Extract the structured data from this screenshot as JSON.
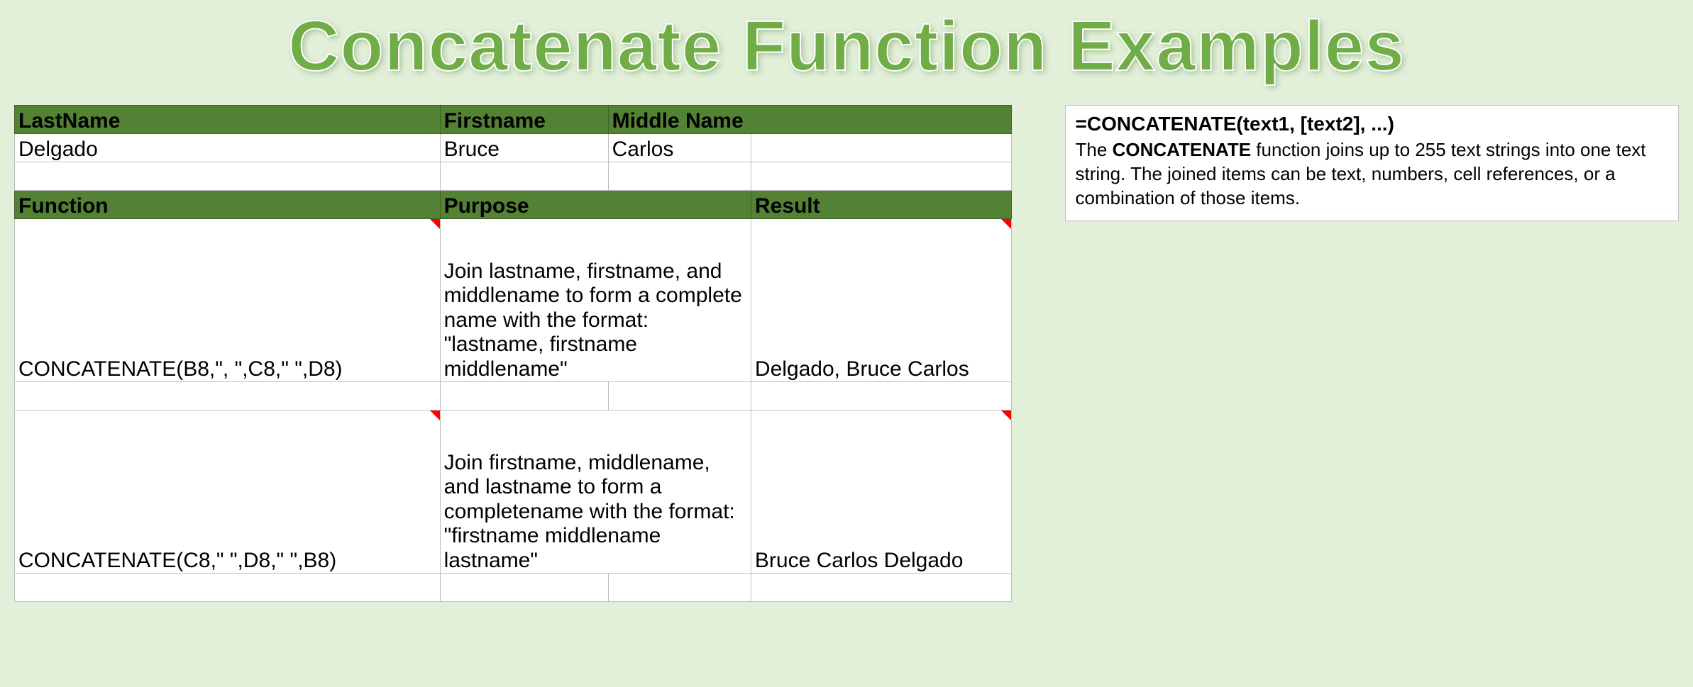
{
  "title": "Concatenate Function Examples",
  "table": {
    "header1": {
      "col1": "LastName",
      "col2": "Firstname",
      "col3": "Middle Name"
    },
    "data1": {
      "col1": "Delgado",
      "col2": "Bruce",
      "col3": "Carlos"
    },
    "header2": {
      "col1": "Function",
      "col2": "Purpose",
      "col4": "Result"
    },
    "row1": {
      "func": "CONCATENATE(B8,\", \",C8,\" \",D8)",
      "purpose": "Join lastname, firstname, and middlename to form a complete name with the format: \"lastname, firstname middlename\"",
      "result": "Delgado, Bruce Carlos"
    },
    "row2": {
      "func": "CONCATENATE(C8,\" \",D8,\" \",B8)",
      "purpose": "Join firstname, middlename, and lastname to form a completename with the format: \"firstname middlename lastname\"",
      "result": "Bruce Carlos Delgado"
    }
  },
  "info": {
    "syntax": "=CONCATENATE(text1, [text2], ...)",
    "desc_pre": "The ",
    "desc_bold": "CONCATENATE",
    "desc_post": " function joins up to 255 text strings into one text string. The joined items can be text, numbers, cell references, or a combination of those items."
  }
}
